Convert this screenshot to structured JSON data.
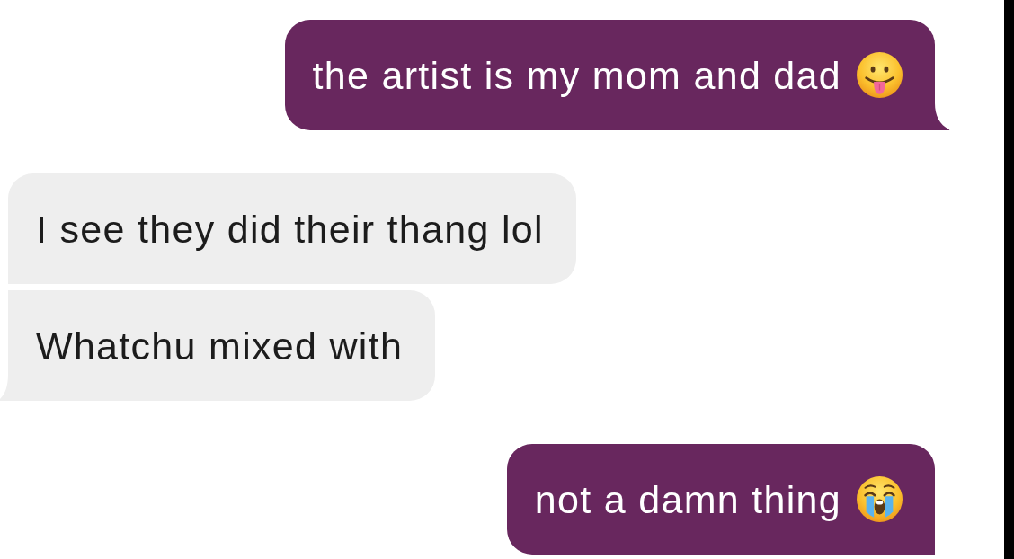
{
  "messages": [
    {
      "kind": "sent",
      "text": "the artist is my mom and dad",
      "emoji": {
        "kind": "tongue-out"
      },
      "tail": true
    },
    {
      "kind": "received",
      "text": "I see they did their thang lol",
      "tail": false
    },
    {
      "kind": "received",
      "text": "Whatchu mixed with",
      "tail": true
    },
    {
      "kind": "sent",
      "text": "not a damn thing",
      "emoji": {
        "kind": "loudly-crying"
      },
      "tail": false
    }
  ]
}
